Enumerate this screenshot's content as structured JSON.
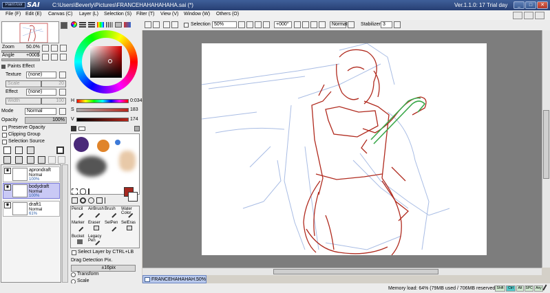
{
  "window": {
    "title": "C:\\Users\\Beverly\\Pictures\\FRANCEHAHAHAHAHA.sai (*)",
    "logo_small": "PaintTool",
    "logo_big": "SAI",
    "version": "Ver.1.1.0: 17 Trial day",
    "min": "_",
    "max": "□",
    "close": "✕"
  },
  "menu": [
    "File (F)",
    "Edit (E)",
    "Canvas (C)",
    "Layer (L)",
    "Selection (S)",
    "Filter (T)",
    "View (V)",
    "Window (W)",
    "Others (O)"
  ],
  "navigator": {
    "zoom_label": "Zoom",
    "zoom_value": "50.0%",
    "angle_label": "Angle",
    "angle_value": "+000$"
  },
  "paints_effect": {
    "header": "Paints Effect",
    "texture_label": "Texture",
    "texture_value": "(none)",
    "scale_label": "Scale",
    "scale_value": "100%",
    "scale_num": "20",
    "effect_label": "Effect",
    "effect_value": "(none)",
    "width_label": "Width",
    "width_value": "1",
    "width_num": "100"
  },
  "layer_props": {
    "mode_label": "Mode",
    "mode_value": "Normal",
    "opacity_label": "Opacity",
    "opacity_value": "100%",
    "preserve_opacity": "Preserve Opacity",
    "clipping_group": "Clipping Group",
    "selection_source": "Selection Source"
  },
  "layers": [
    {
      "name": "aprondraft",
      "mode": "Normal",
      "opacity": "100%",
      "selected": false
    },
    {
      "name": "bodydraft",
      "mode": "Normal",
      "opacity": "100%",
      "selected": true
    },
    {
      "name": "draft1",
      "mode": "Normal",
      "opacity": "61%",
      "selected": false
    }
  ],
  "color": {
    "h_label": "H",
    "h_value": "0:034",
    "s_label": "S",
    "s_value": "183",
    "v_label": "V",
    "v_value": "174",
    "main_color": "#a5281f"
  },
  "tools": [
    {
      "label": "Pencil"
    },
    {
      "label": "AirBrush"
    },
    {
      "label": "Brush"
    },
    {
      "label": "Water Color"
    },
    {
      "label": "Marker"
    },
    {
      "label": "Eraser"
    },
    {
      "label": "SelPen"
    },
    {
      "label": "SelEras"
    },
    {
      "label": "Bucket"
    },
    {
      "label": "Legacy Pen"
    }
  ],
  "tool_options": {
    "select_layer": "Select Layer by CTRL+LB",
    "drag_detection": "Drag Detection Pix.",
    "drag_value": "±16pix",
    "transform": "Transform",
    "scale": "Scale"
  },
  "toolbar": {
    "selection_label": "Selection",
    "zoom_value": "50%",
    "angle_value": "+000°",
    "mode_value": "Normal",
    "stabilizer_label": "Stabilizer",
    "stabilizer_value": "3"
  },
  "doc_tab": {
    "name": "FRANCEHAHAHAH...",
    "zoom": "50%"
  },
  "status": {
    "memory": "Memory load: 64% (79MB used / 706MB reserved)",
    "indicators": [
      "Shift",
      "Ctrl",
      "Alt",
      "SPC",
      "Any"
    ]
  }
}
